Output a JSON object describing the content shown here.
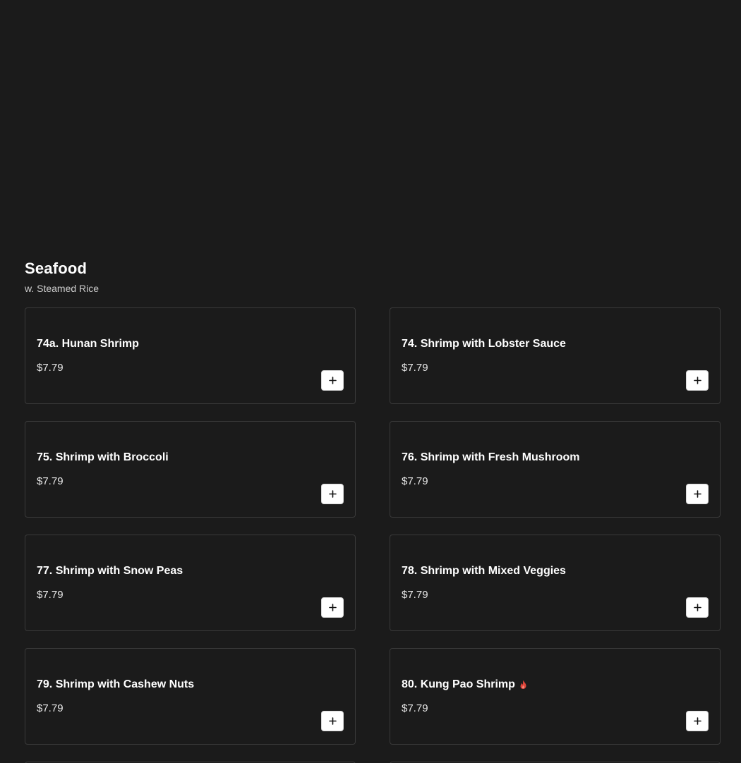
{
  "section": {
    "title": "Seafood",
    "subtitle": "w. Steamed Rice"
  },
  "items": [
    {
      "name": "74a. Hunan Shrimp",
      "price": "$7.79",
      "spicy": false
    },
    {
      "name": "74. Shrimp with Lobster Sauce",
      "price": "$7.79",
      "spicy": false
    },
    {
      "name": "75. Shrimp with Broccoli",
      "price": "$7.79",
      "spicy": false
    },
    {
      "name": "76. Shrimp with Fresh Mushroom",
      "price": "$7.79",
      "spicy": false
    },
    {
      "name": "77. Shrimp with Snow Peas",
      "price": "$7.79",
      "spicy": false
    },
    {
      "name": "78. Shrimp with Mixed Veggies",
      "price": "$7.79",
      "spicy": false
    },
    {
      "name": "79. Shrimp with Cashew Nuts",
      "price": "$7.79",
      "spicy": false
    },
    {
      "name": "80. Kung Pao Shrimp",
      "price": "$7.79",
      "spicy": true
    }
  ],
  "icons": {
    "add": "plus-icon",
    "spicy": "flame-icon"
  },
  "colors": {
    "background": "#1b1b1b",
    "card_border": "#3a3a3a",
    "spicy": "#e0453a",
    "button_bg": "#ffffff"
  }
}
